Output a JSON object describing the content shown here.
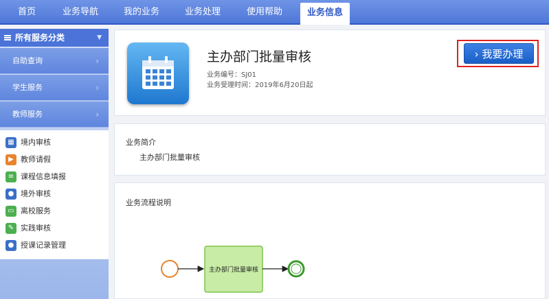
{
  "nav": {
    "items": [
      {
        "label": "首页"
      },
      {
        "label": "业务导航"
      },
      {
        "label": "我的业务"
      },
      {
        "label": "业务处理"
      },
      {
        "label": "使用帮助"
      },
      {
        "label": "业务信息",
        "active": true
      }
    ]
  },
  "sidebar": {
    "header": "所有服务分类",
    "categories": [
      {
        "label": "自助查询"
      },
      {
        "label": "学生服务"
      },
      {
        "label": "教师服务"
      }
    ],
    "links": [
      {
        "label": "境内审核",
        "icon": "calendar-icon",
        "color": "#3a6fc8"
      },
      {
        "label": "教师请假",
        "icon": "video-icon",
        "color": "#e8842c"
      },
      {
        "label": "课程信息填报",
        "icon": "form-icon",
        "color": "#4caf50"
      },
      {
        "label": "境外审核",
        "icon": "user-icon",
        "color": "#3a6fc8"
      },
      {
        "label": "离校服务",
        "icon": "monitor-icon",
        "color": "#4caf50"
      },
      {
        "label": "实践审核",
        "icon": "edit-icon",
        "color": "#4caf50"
      },
      {
        "label": "授课记录管理",
        "icon": "user-icon",
        "color": "#3a6fc8"
      }
    ]
  },
  "service": {
    "title": "主办部门批量审核",
    "code_label": "业务编号：",
    "code_value": "SJ01",
    "time_label": "业务受理时间：",
    "time_value": "2019年6月20日起",
    "apply_button": "我要办理"
  },
  "intro": {
    "heading": "业务简介",
    "body": "主办部门批量审核"
  },
  "flow": {
    "heading": "业务流程说明",
    "task_label": "主办部门批量审核"
  },
  "colors": {
    "nav_bg": "#5a80dc",
    "accent": "#1a5fc7",
    "highlight_border": "#e02020",
    "start_event": "#e8842c",
    "end_event": "#3c9a2c",
    "task_fill": "#c8eca6"
  }
}
